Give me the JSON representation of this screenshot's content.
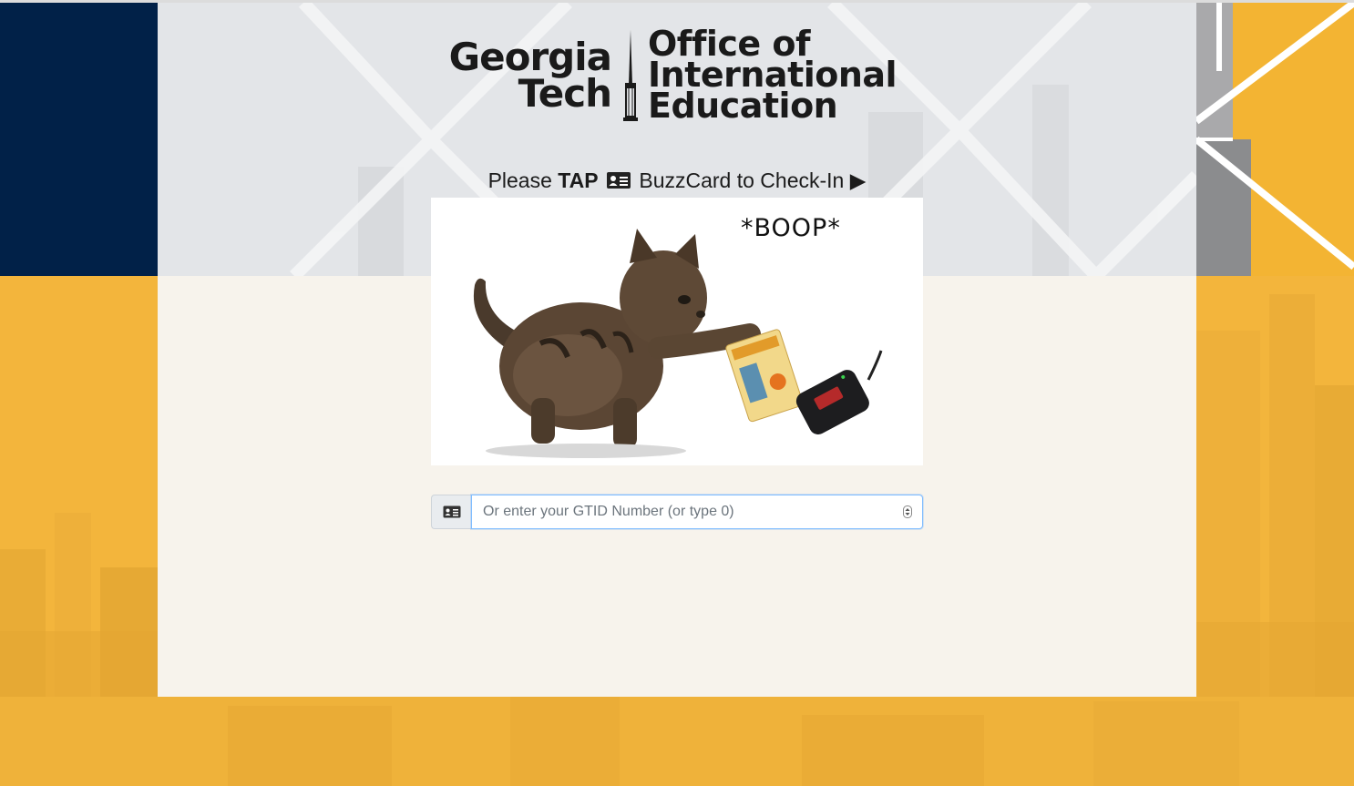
{
  "logo": {
    "left_line1": "Georgia",
    "left_line2": "Tech",
    "right_line1": "Office of",
    "right_line2": "International",
    "right_line3": "Education"
  },
  "prompt": {
    "pre": "Please ",
    "bold": "TAP",
    "post": " BuzzCard to Check-In ",
    "arrow": "▶",
    "icon": "id-card-icon"
  },
  "illustration": {
    "caption": "*BOOP*"
  },
  "gtid": {
    "placeholder": "Or enter your GTID Number (or type 0)",
    "value": "",
    "addon_icon": "id-card-icon"
  },
  "colors": {
    "navy": "#012148",
    "gold": "#f3b433",
    "card_bg": "#f7f3ec",
    "header_bg": "#e4e6e9"
  }
}
